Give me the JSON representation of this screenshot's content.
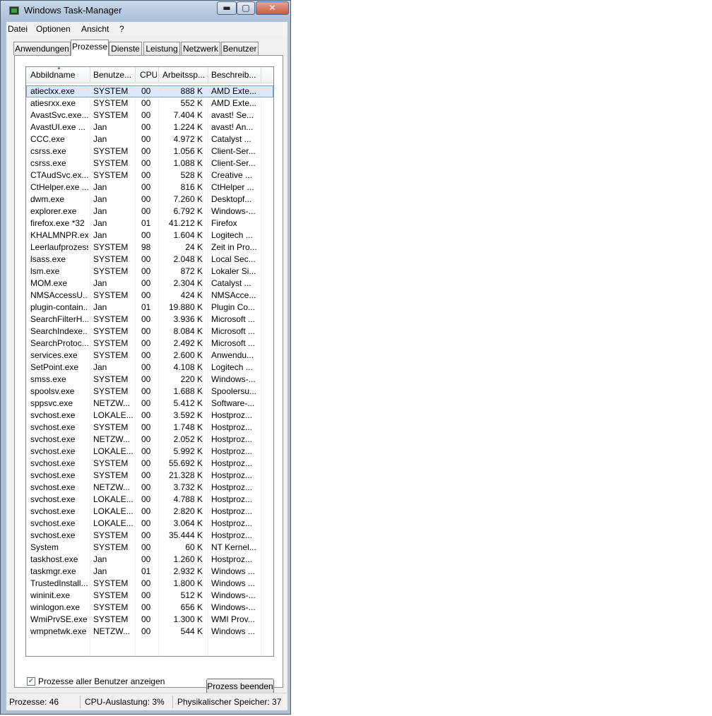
{
  "window": {
    "title": "Windows Task-Manager",
    "minimize": "▬",
    "maximize": "▢",
    "close": "✕"
  },
  "menu": [
    "Datei",
    "Optionen",
    "Ansicht",
    "?"
  ],
  "tabs": [
    "Anwendungen",
    "Prozesse",
    "Dienste",
    "Leistung",
    "Netzwerk",
    "Benutzer"
  ],
  "columns": [
    "Abbildname",
    "Benutze...",
    "CPU",
    "Arbeitssp...",
    "Beschreib..."
  ],
  "processes": [
    [
      "atieclxx.exe",
      "SYSTEM",
      "00",
      "888 K",
      "AMD Exte..."
    ],
    [
      "atiesrxx.exe",
      "SYSTEM",
      "00",
      "552 K",
      "AMD Exte..."
    ],
    [
      "AvastSvc.exe...",
      "SYSTEM",
      "00",
      "7.404 K",
      "avast! Se..."
    ],
    [
      "AvastUI.exe ...",
      "Jan",
      "00",
      "1.224 K",
      "avast! An..."
    ],
    [
      "CCC.exe",
      "Jan",
      "00",
      "4.972 K",
      "Catalyst ..."
    ],
    [
      "csrss.exe",
      "SYSTEM",
      "00",
      "1.056 K",
      "Client-Ser..."
    ],
    [
      "csrss.exe",
      "SYSTEM",
      "00",
      "1.088 K",
      "Client-Ser..."
    ],
    [
      "CTAudSvc.ex...",
      "SYSTEM",
      "00",
      "528 K",
      "Creative ..."
    ],
    [
      "CtHelper.exe ...",
      "Jan",
      "00",
      "816 K",
      "CtHelper ..."
    ],
    [
      "dwm.exe",
      "Jan",
      "00",
      "7.260 K",
      "Desktopf..."
    ],
    [
      "explorer.exe",
      "Jan",
      "00",
      "6.792 K",
      "Windows-..."
    ],
    [
      "firefox.exe *32",
      "Jan",
      "01",
      "41.212 K",
      "Firefox"
    ],
    [
      "KHALMNPR.exe",
      "Jan",
      "00",
      "1.604 K",
      "Logitech ..."
    ],
    [
      "Leerlaufprozess",
      "SYSTEM",
      "98",
      "24 K",
      "Zeit in Pro..."
    ],
    [
      "lsass.exe",
      "SYSTEM",
      "00",
      "2.048 K",
      "Local Sec..."
    ],
    [
      "lsm.exe",
      "SYSTEM",
      "00",
      "872 K",
      "Lokaler Si..."
    ],
    [
      "MOM.exe",
      "Jan",
      "00",
      "2.304 K",
      "Catalyst ..."
    ],
    [
      "NMSAccessU....",
      "SYSTEM",
      "00",
      "424 K",
      "NMSAcce..."
    ],
    [
      "plugin-contain...",
      "Jan",
      "01",
      "19.880 K",
      "Plugin Co..."
    ],
    [
      "SearchFilterH...",
      "SYSTEM",
      "00",
      "3.936 K",
      "Microsoft ..."
    ],
    [
      "SearchIndexe...",
      "SYSTEM",
      "00",
      "8.084 K",
      "Microsoft ..."
    ],
    [
      "SearchProtoc...",
      "SYSTEM",
      "00",
      "2.492 K",
      "Microsoft ..."
    ],
    [
      "services.exe",
      "SYSTEM",
      "00",
      "2.600 K",
      "Anwendu..."
    ],
    [
      "SetPoint.exe",
      "Jan",
      "00",
      "4.108 K",
      "Logitech ..."
    ],
    [
      "smss.exe",
      "SYSTEM",
      "00",
      "220 K",
      "Windows-..."
    ],
    [
      "spoolsv.exe",
      "SYSTEM",
      "00",
      "1.688 K",
      "Spoolersu..."
    ],
    [
      "sppsvc.exe",
      "NETZW...",
      "00",
      "5.412 K",
      "Software-..."
    ],
    [
      "svchost.exe",
      "LOKALE...",
      "00",
      "3.592 K",
      "Hostproz..."
    ],
    [
      "svchost.exe",
      "SYSTEM",
      "00",
      "1.748 K",
      "Hostproz..."
    ],
    [
      "svchost.exe",
      "NETZW...",
      "00",
      "2.052 K",
      "Hostproz..."
    ],
    [
      "svchost.exe",
      "LOKALE...",
      "00",
      "5.992 K",
      "Hostproz..."
    ],
    [
      "svchost.exe",
      "SYSTEM",
      "00",
      "55.692 K",
      "Hostproz..."
    ],
    [
      "svchost.exe",
      "SYSTEM",
      "00",
      "21.328 K",
      "Hostproz..."
    ],
    [
      "svchost.exe",
      "NETZW...",
      "00",
      "3.732 K",
      "Hostproz..."
    ],
    [
      "svchost.exe",
      "LOKALE...",
      "00",
      "4.788 K",
      "Hostproz..."
    ],
    [
      "svchost.exe",
      "LOKALE...",
      "00",
      "2.820 K",
      "Hostproz..."
    ],
    [
      "svchost.exe",
      "LOKALE...",
      "00",
      "3.064 K",
      "Hostproz..."
    ],
    [
      "svchost.exe",
      "SYSTEM",
      "00",
      "35.444 K",
      "Hostproz..."
    ],
    [
      "System",
      "SYSTEM",
      "00",
      "60 K",
      "NT Kernel..."
    ],
    [
      "taskhost.exe",
      "Jan",
      "00",
      "1.260 K",
      "Hostproz..."
    ],
    [
      "taskmgr.exe",
      "Jan",
      "01",
      "2.932 K",
      "Windows ..."
    ],
    [
      "TrustedInstall...",
      "SYSTEM",
      "00",
      "1.800 K",
      "Windows ..."
    ],
    [
      "wininit.exe",
      "SYSTEM",
      "00",
      "512 K",
      "Windows-..."
    ],
    [
      "winlogon.exe",
      "SYSTEM",
      "00",
      "656 K",
      "Windows-..."
    ],
    [
      "WmiPrvSE.exe",
      "SYSTEM",
      "00",
      "1.300 K",
      "WMI Prov..."
    ],
    [
      "wmpnetwk.exe",
      "NETZW...",
      "00",
      "544 K",
      "Windows ..."
    ]
  ],
  "selected_row": 0,
  "show_all_users": {
    "label": "Prozesse aller Benutzer anzeigen",
    "checked": true,
    "check": "✓"
  },
  "end_process_label": "Prozess beenden",
  "status": {
    "processes": "Prozesse: 46",
    "cpu": "CPU-Auslastung: 3%",
    "memory": "Physikalischer Speicher: 37"
  },
  "colors": {
    "selection": "#dbe9f8",
    "selection_border": "#7da2ce",
    "titlebar": "#b9cade"
  }
}
